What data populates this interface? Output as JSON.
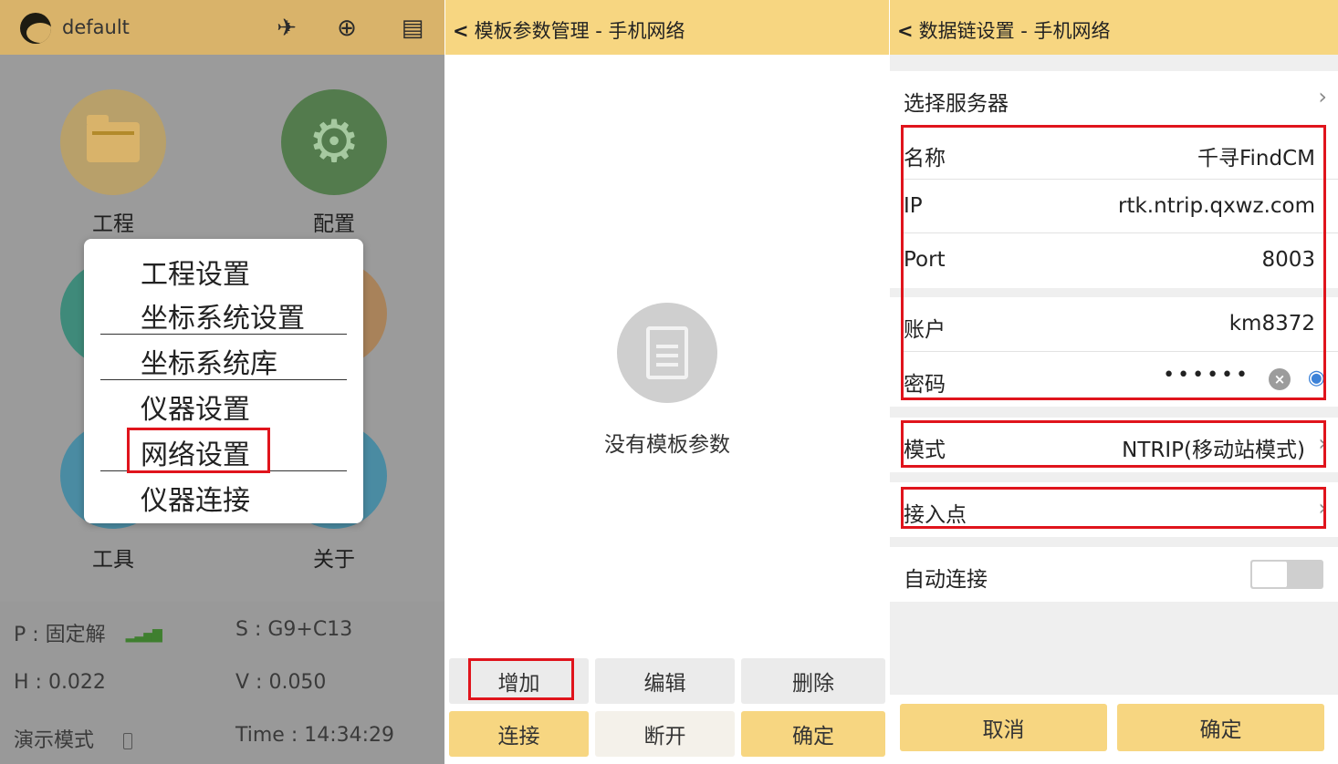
{
  "screen1": {
    "app_title": "default",
    "toolbar_icons": [
      "satellite-icon",
      "crosshair-icon",
      "settings-window-icon"
    ],
    "apps": [
      {
        "label": "工程",
        "icon": "folder-icon",
        "color": "#d9b36a"
      },
      {
        "label": "配置",
        "icon": "gear-icon",
        "color": "#4f9b47"
      },
      {
        "label": "工具",
        "icon": "tools-icon",
        "color": "#3b95b8"
      },
      {
        "label": "关于",
        "icon": "info-icon",
        "color": "#3b95b8"
      }
    ],
    "menu": {
      "items": [
        "工程设置",
        "坐标系统设置",
        "坐标系统库",
        "仪器设置",
        "网络设置",
        "仪器连接"
      ]
    },
    "status": {
      "p": "P : 固定解",
      "s": "S : G9+C13",
      "h": "H : 0.022",
      "v": "V : 0.050",
      "mode": "演示模式",
      "time": "Time :  14:34:29"
    }
  },
  "screen2": {
    "title": "模板参数管理 - 手机网络",
    "empty_text": "没有模板参数",
    "buttons": {
      "add": "增加",
      "edit": "编辑",
      "delete": "删除",
      "connect": "连接",
      "disconnect": "断开",
      "confirm": "确定"
    }
  },
  "screen3": {
    "title": "数据链设置 - 手机网络",
    "select_server": "选择服务器",
    "name_label": "名称",
    "name_value": "千寻FindCM",
    "ip_label": "IP",
    "ip_value": "rtk.ntrip.qxwz.com",
    "port_label": "Port",
    "port_value": "8003",
    "account_label": "账户",
    "account_value": "km8372",
    "password_label": "密码",
    "password_masked": "••••••",
    "mode_label": "模式",
    "mode_value": "NTRIP(移动站模式)",
    "mountpoint_label": "接入点",
    "autoconnect_label": "自动连接",
    "autoconnect_on": false,
    "cancel": "取消",
    "confirm": "确定"
  },
  "colors": {
    "accent_yellow": "#f7d681",
    "highlight_red": "#e0141c"
  }
}
